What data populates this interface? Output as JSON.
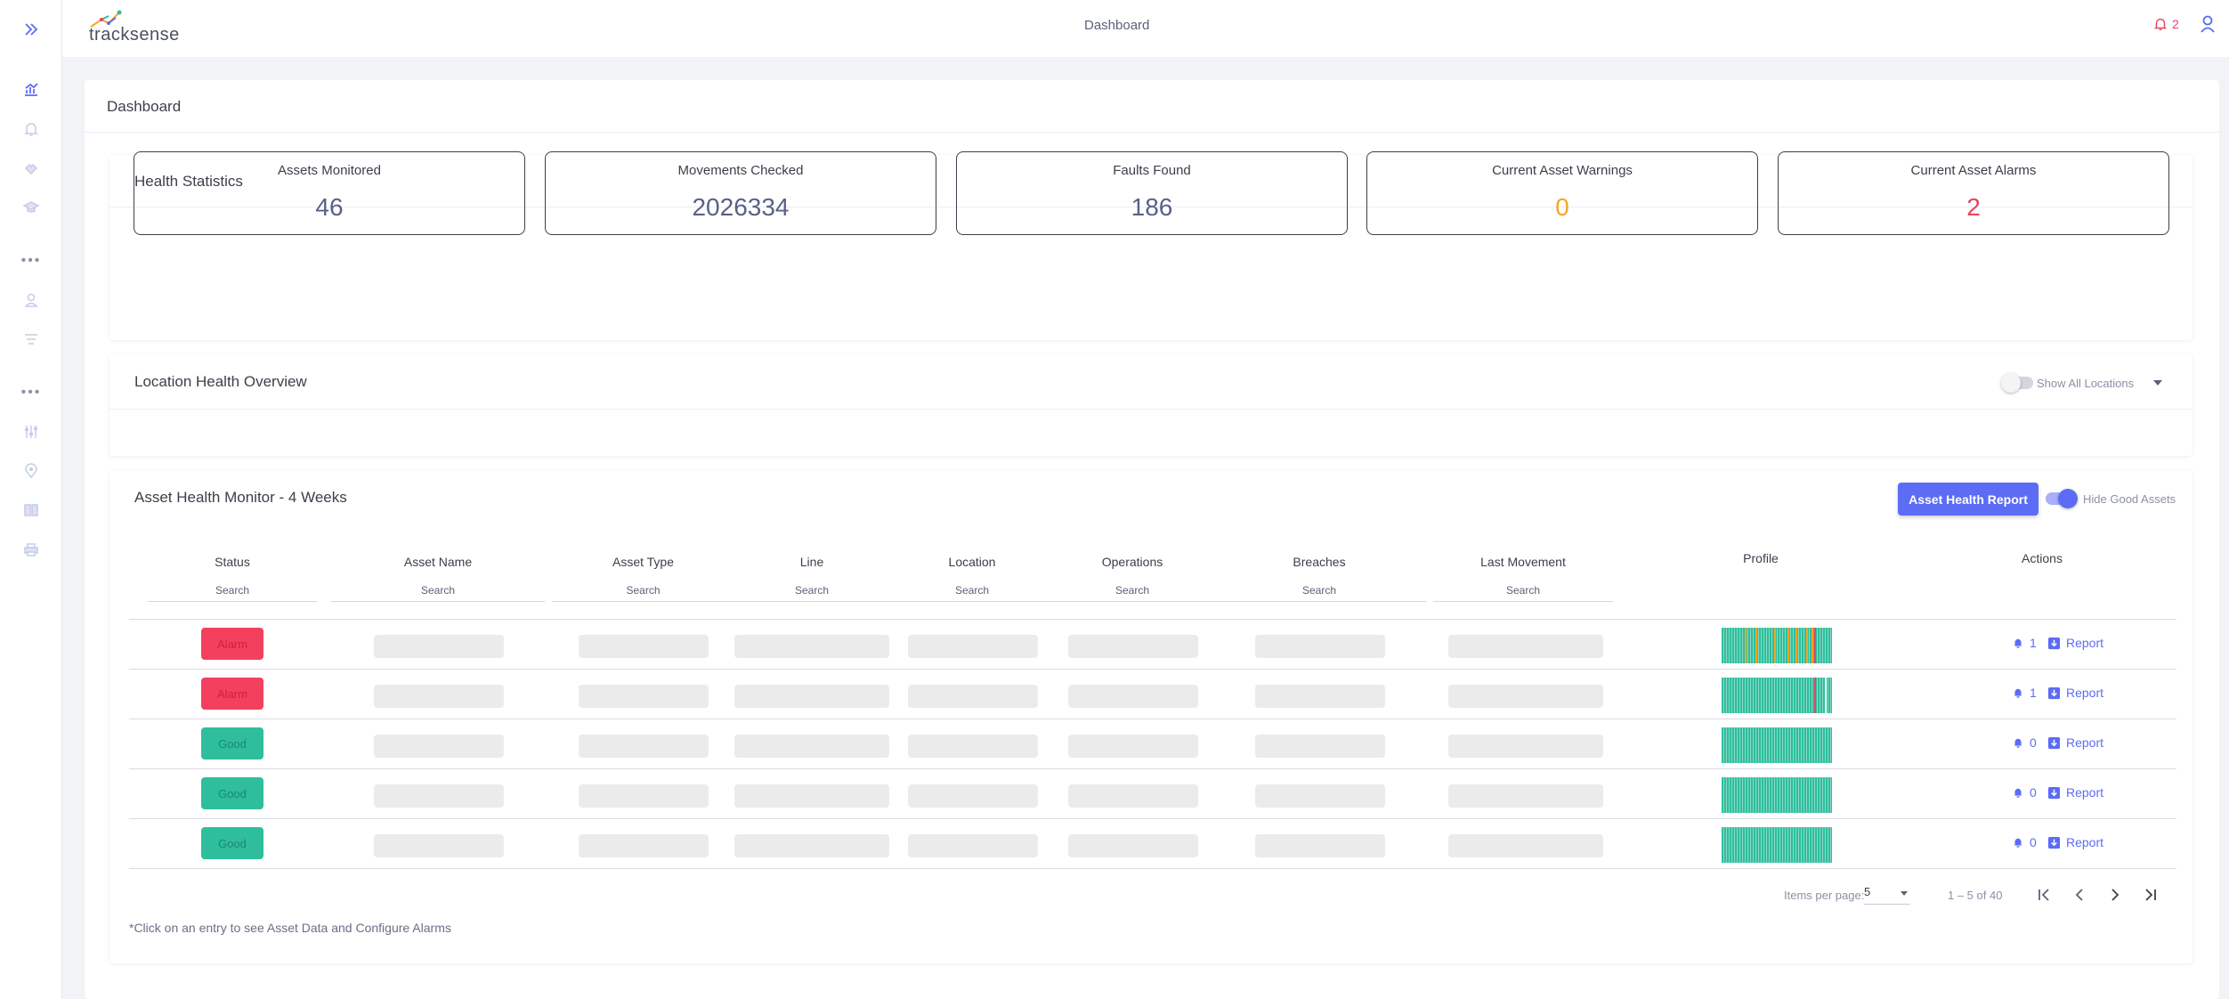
{
  "app": {
    "logo_text": "tracksense",
    "page_title": "Dashboard",
    "notification_count": "2"
  },
  "colors": {
    "accent": "#5c6cf5",
    "alarm": "#f3405f",
    "good": "#2fbe9c",
    "warning": "#f5a623"
  },
  "sidebar": {
    "icons": [
      "expand-icon",
      "chart-icon",
      "bell-icon",
      "hands-icon",
      "graduation-icon",
      "user-icon",
      "filter-icon",
      "sliders-icon",
      "location-icon",
      "book-icon",
      "printer-icon"
    ]
  },
  "dashboard": {
    "title": "Dashboard"
  },
  "health_statistics": {
    "title": "Health Statistics",
    "stats": [
      {
        "label": "Assets Monitored",
        "value": "46"
      },
      {
        "label": "Movements Checked",
        "value": "2026334"
      },
      {
        "label": "Faults Found",
        "value": "186"
      },
      {
        "label": "Current Asset Warnings",
        "value": "0"
      },
      {
        "label": "Current Asset Alarms",
        "value": "2"
      }
    ]
  },
  "location_overview": {
    "title": "Location Health Overview",
    "toggle_label": "Show All Locations"
  },
  "asset_monitor": {
    "title": "Asset Health Monitor - 4 Weeks",
    "report_button": "Asset Health Report",
    "toggle_label": "Hide Good Assets",
    "columns": [
      "Status",
      "Asset Name",
      "Asset Type",
      "Line",
      "Location",
      "Operations",
      "Breaches",
      "Last Movement",
      "Profile",
      "Actions"
    ],
    "search_placeholder": "Search",
    "rows": [
      {
        "status": "Alarm",
        "alarms": "1",
        "report": "Report"
      },
      {
        "status": "Alarm",
        "alarms": "1",
        "report": "Report"
      },
      {
        "status": "Good",
        "alarms": "0",
        "report": "Report"
      },
      {
        "status": "Good",
        "alarms": "0",
        "report": "Report"
      },
      {
        "status": "Good",
        "alarms": "0",
        "report": "Report"
      }
    ],
    "pagination": {
      "items_per_page_label": "Items per page:",
      "items_per_page": "5",
      "range": "1 – 5 of 40"
    },
    "footnote": "*Click on an entry to see Asset Data and Configure Alarms"
  }
}
